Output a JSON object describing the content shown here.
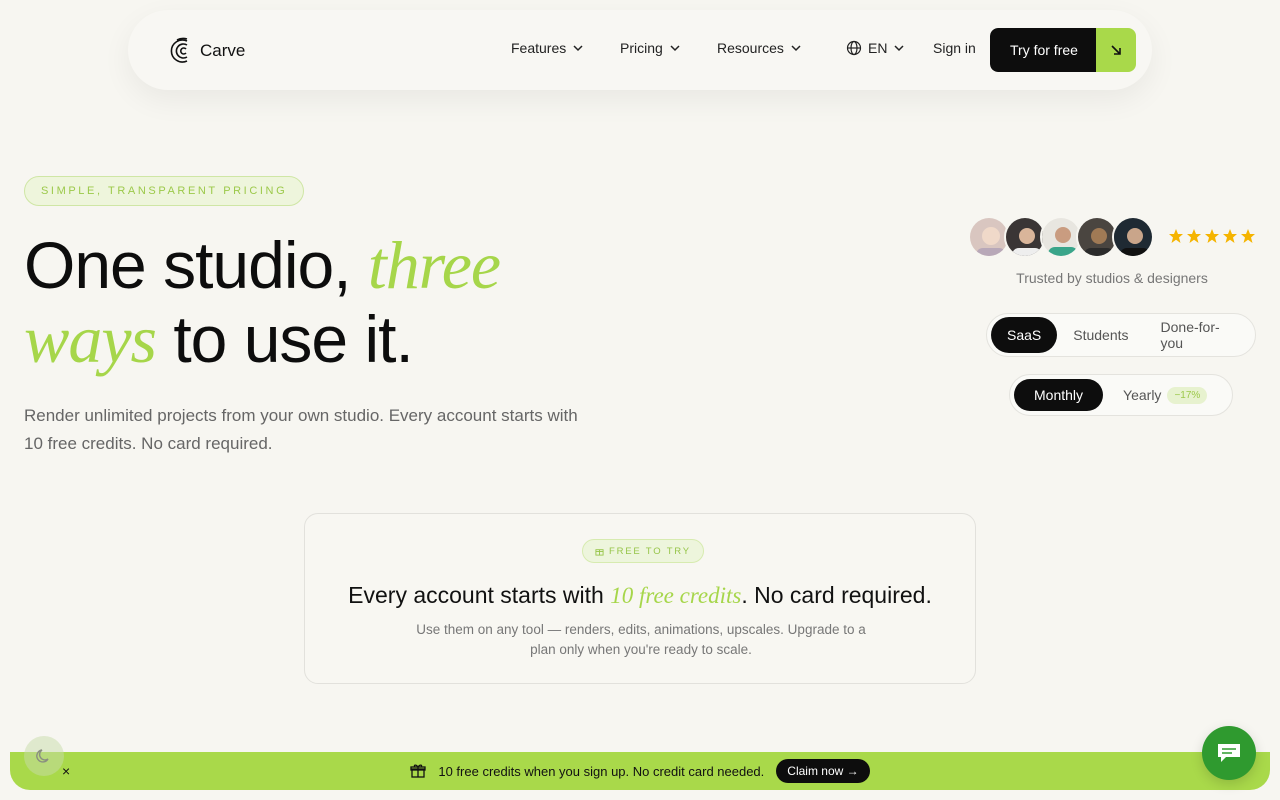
{
  "nav": {
    "brand": "Carve",
    "items": [
      {
        "label": "Features"
      },
      {
        "label": "Pricing"
      },
      {
        "label": "Resources"
      }
    ],
    "language": "EN",
    "sign_in": "Sign in",
    "cta": "Try for free"
  },
  "hero": {
    "tag": "SIMPLE, TRANSPARENT PRICING",
    "headline_part1": "One studio, ",
    "headline_em1": "three",
    "headline_em2": "ways",
    "headline_part2": " to use it.",
    "subtitle": "Render unlimited projects from your own studio. Every account starts with 10 free credits. No card required."
  },
  "social_proof": {
    "rating": 5,
    "trusted_text": "Trusted by studios & designers"
  },
  "plan_types": {
    "options": [
      "SaaS",
      "Students",
      "Done-for-you"
    ],
    "selected": "SaaS"
  },
  "billing": {
    "monthly": "Monthly",
    "yearly": "Yearly",
    "discount": "−17%",
    "selected": "Monthly"
  },
  "free_card": {
    "tag": "FREE TO TRY",
    "title_pre": "Every account starts with ",
    "title_em": "10 free credits",
    "title_post": ". No card required.",
    "body": "Use them on any tool — renders, edits, animations, upscales. Upgrade to a plan only when you're ready to scale."
  },
  "banner": {
    "text": "10 free credits when you sign up. No credit card needed.",
    "cta": "Claim now →",
    "close": "×"
  },
  "colors": {
    "accent": "#a9d94a",
    "dark": "#0d0d0d",
    "background": "#f7f6f1",
    "star": "#f5b400"
  }
}
